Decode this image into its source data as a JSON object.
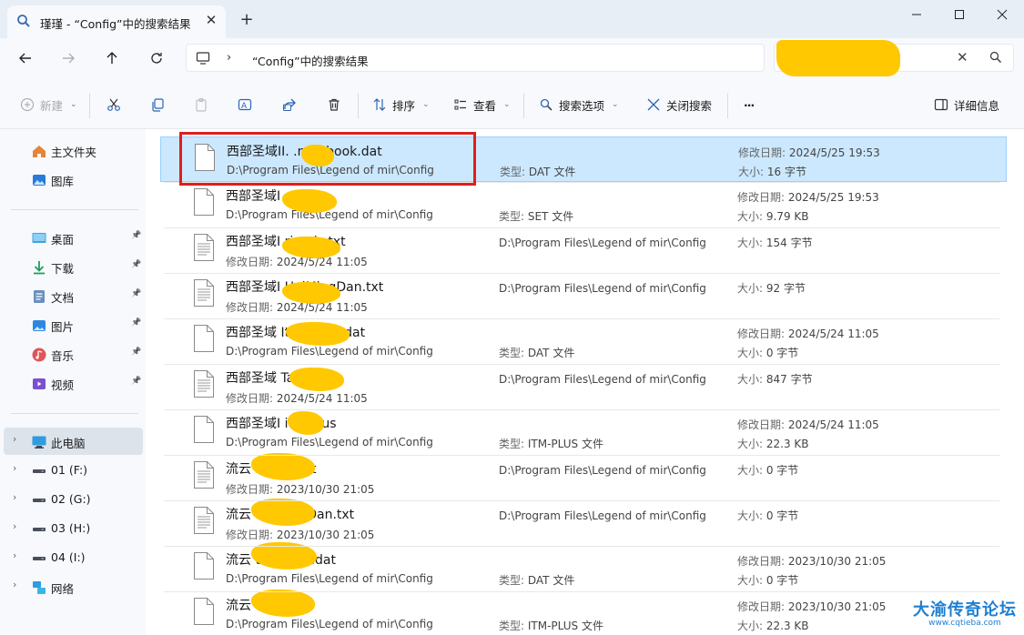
{
  "window": {
    "tab_title": "瑾瑾 - “Config”中的搜索结果",
    "new_tab": "+",
    "close_tab": "✕"
  },
  "addressbar": {
    "separator": "›",
    "crumb": "“Config”中的搜索结果"
  },
  "commandbar": {
    "new_label": "新建",
    "sort_label": "排序",
    "view_label": "查看",
    "search_options_label": "搜索选项",
    "close_search_label": "关闭搜索",
    "more_label": "···",
    "details_label": "详细信息"
  },
  "sidebar": {
    "quick": [
      {
        "label": "主文件夹",
        "icon": "home-icon"
      },
      {
        "label": "图库",
        "icon": "gallery-icon"
      }
    ],
    "pinned": [
      {
        "label": "桌面",
        "icon": "desktop-icon"
      },
      {
        "label": "下载",
        "icon": "download-icon"
      },
      {
        "label": "文档",
        "icon": "documents-icon"
      },
      {
        "label": "图片",
        "icon": "pictures-icon"
      },
      {
        "label": "音乐",
        "icon": "music-icon"
      },
      {
        "label": "视频",
        "icon": "videos-icon"
      }
    ],
    "tree": [
      {
        "label": "此电脑",
        "icon": "this-pc-icon"
      },
      {
        "label": "01 (F:)",
        "icon": "drive-icon"
      },
      {
        "label": "02 (G:)",
        "icon": "drive-icon"
      },
      {
        "label": "03 (H:)",
        "icon": "drive-icon"
      },
      {
        "label": "04 (I:)",
        "icon": "drive-icon"
      },
      {
        "label": "网络",
        "icon": "network-icon"
      }
    ],
    "pin_glyph": "📌",
    "expand_glyph": "›"
  },
  "labels": {
    "type": "类型:",
    "modified": "修改日期:",
    "size": "大小:"
  },
  "files": [
    {
      "name": "西部圣域II.     .notebook.dat",
      "path": "D:\\Program Files\\Legend of mir\\Config",
      "type": "DAT 文件",
      "modified": "2024/5/25 19:53",
      "size": "16 字节",
      "layout": "a"
    },
    {
      "name": "西部圣域I           set",
      "path": "D:\\Program Files\\Legend of mir\\Config",
      "type": "SET 文件",
      "modified": "2024/5/25 19:53",
      "size": "9.79 KB",
      "layout": "a"
    },
    {
      "name": "西部圣域I         riends.txt",
      "path": "D:\\Program Files\\Legend of mir\\Config",
      "type": "",
      "modified": "2024/5/24 11:05",
      "size": "154 字节",
      "layout": "b"
    },
    {
      "name": "西部圣域I         HeiMingDan.txt",
      "path": "D:\\Program Files\\Legend of mir\\Config",
      "type": "",
      "modified": "2024/5/24 11:05",
      "size": "92 字节",
      "layout": "b"
    },
    {
      "name": "西部圣域          ItemFilter.dat",
      "path": "D:\\Program Files\\Legend of mir\\Config",
      "type": "DAT 文件",
      "modified": "2024/5/24 11:05",
      "size": "0 字节",
      "layout": "a"
    },
    {
      "name": "西部圣域          Target.txt",
      "path": "D:\\Program Files\\Legend of mir\\Config",
      "type": "",
      "modified": "2024/5/24 11:05",
      "size": "847 字节",
      "layout": "b"
    },
    {
      "name": "西部圣域I        itm-plus",
      "path": "D:\\Program Files\\Legend of mir\\Config",
      "type": "ITM-PLUS 文件",
      "modified": "2024/5/24 11:05",
      "size": "22.3 KB",
      "layout": "a"
    },
    {
      "name": "流云            riends.txt",
      "path": "D:\\Program Files\\Legend of mir\\Config",
      "type": "",
      "modified": "2023/10/30 21:05",
      "size": "0 字节",
      "layout": "b"
    },
    {
      "name": "流云            HeiMingDan.txt",
      "path": "D:\\Program Files\\Legend of mir\\Config",
      "type": "",
      "modified": "2023/10/30 21:05",
      "size": "0 字节",
      "layout": "b"
    },
    {
      "name": "流云            temFilter.dat",
      "path": "D:\\Program Files\\Legend of mir\\Config",
      "type": "DAT 文件",
      "modified": "2023/10/30 21:05",
      "size": "0 字节",
      "layout": "a"
    },
    {
      "name": "流云            tm-plus",
      "path": "D:\\Program Files\\Legend of mir\\Config",
      "type": "ITM-PLUS 文件",
      "modified": "2023/10/30 21:05",
      "size": "22.3 KB",
      "layout": "a"
    }
  ],
  "watermark": {
    "main": "大渝传奇论坛",
    "url": "www.cqtieba.com"
  },
  "colors": {
    "selection": "#cce8ff",
    "highlight_box": "#e01e1e",
    "redaction": "#ffc800",
    "watermark": "#1d7fd2"
  }
}
